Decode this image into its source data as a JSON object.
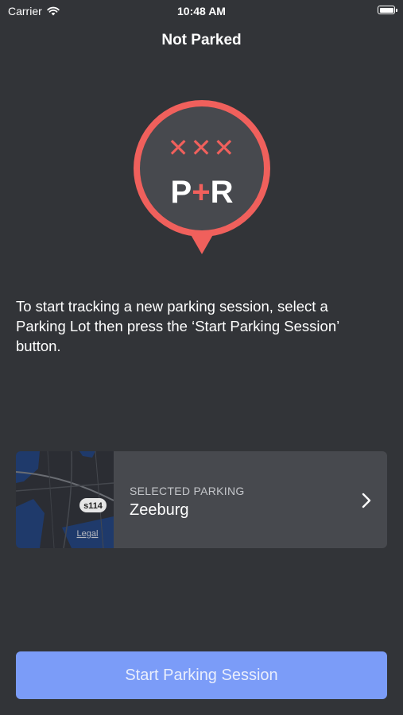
{
  "status_bar": {
    "carrier": "Carrier",
    "time": "10:48 AM",
    "icons": [
      "wifi-icon",
      "battery-icon"
    ]
  },
  "header": {
    "title": "Not Parked"
  },
  "logo": {
    "marks": "✕✕✕",
    "text_p": "P",
    "text_plus": "+",
    "text_r": "R",
    "accent_color": "#f0605c",
    "fill_color": "#47494e"
  },
  "main": {
    "instructions": "To start tracking a new parking session, select a Parking Lot then press the ‘Start Parking Session’ button."
  },
  "selected_parking": {
    "label": "SELECTED PARKING",
    "value": "Zeeburg",
    "map": {
      "shield": "s114",
      "legal": "Legal"
    },
    "icon": "chevron-right-icon"
  },
  "footer": {
    "start_button_label": "Start Parking Session",
    "button_color": "#7b9cf8"
  }
}
